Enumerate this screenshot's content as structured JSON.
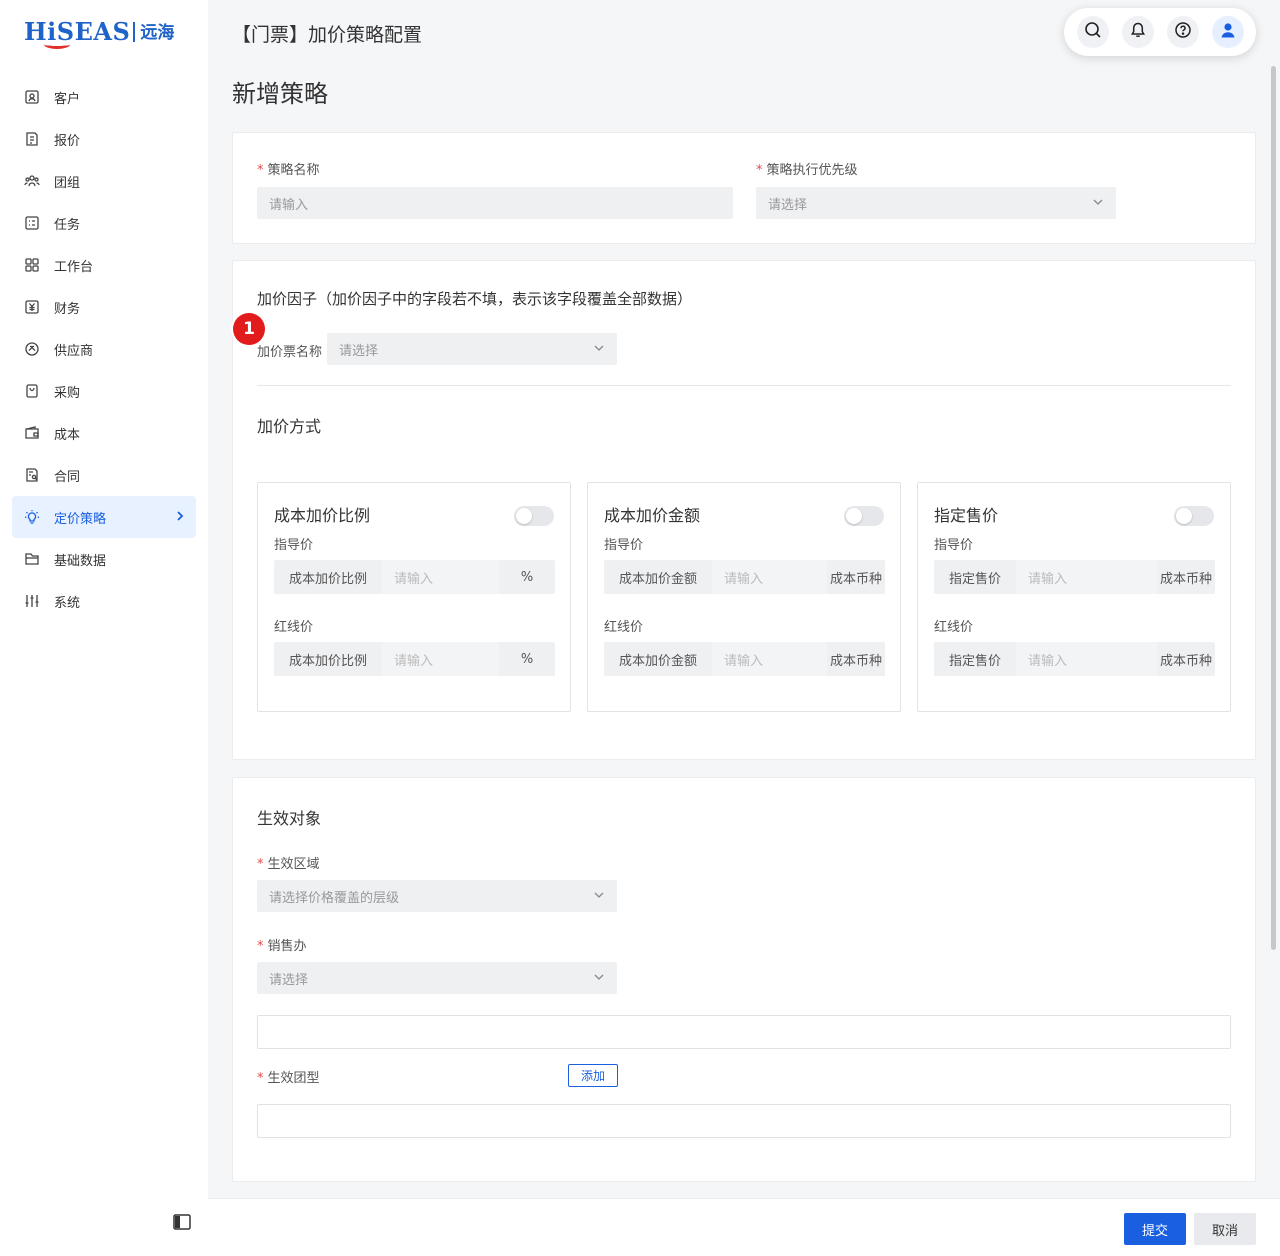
{
  "brand": {
    "name": "HiSEAS",
    "cn": "远海"
  },
  "nav": [
    {
      "label": "客户",
      "icon": "customer-icon"
    },
    {
      "label": "报价",
      "icon": "quote-icon"
    },
    {
      "label": "团组",
      "icon": "group-icon"
    },
    {
      "label": "任务",
      "icon": "task-icon"
    },
    {
      "label": "工作台",
      "icon": "workbench-icon"
    },
    {
      "label": "财务",
      "icon": "finance-icon"
    },
    {
      "label": "供应商",
      "icon": "supplier-icon"
    },
    {
      "label": "采购",
      "icon": "purchase-icon"
    },
    {
      "label": "成本",
      "icon": "cost-icon"
    },
    {
      "label": "合同",
      "icon": "contract-icon"
    },
    {
      "label": "定价策略",
      "icon": "lightbulb-icon",
      "active": true
    },
    {
      "label": "基础数据",
      "icon": "folder-icon"
    },
    {
      "label": "系统",
      "icon": "sliders-icon"
    }
  ],
  "header": {
    "title": "【门票】加价策略配置"
  },
  "page": {
    "title": "新增策略"
  },
  "basic": {
    "name_label": "策略名称",
    "name_placeholder": "请输入",
    "priority_label": "策略执行优先级",
    "priority_placeholder": "请选择"
  },
  "factor": {
    "title": "加价因子（加价因子中的字段若不填，表示该字段覆盖全部数据）",
    "ticket_label": "加价票名称",
    "ticket_placeholder": "请选择",
    "badge": "1"
  },
  "method": {
    "title": "加价方式",
    "cards": [
      {
        "title": "成本加价比例",
        "guide": "指导价",
        "red": "红线价",
        "prefix": "成本加价比例",
        "placeholder": "请输入",
        "suffix": "%"
      },
      {
        "title": "成本加价金额",
        "guide": "指导价",
        "red": "红线价",
        "prefix": "成本加价金额",
        "placeholder": "请输入",
        "suffix": "成本币种"
      },
      {
        "title": "指定售价",
        "guide": "指导价",
        "red": "红线价",
        "prefix": "指定售价",
        "placeholder": "请输入",
        "suffix": "成本币种"
      }
    ]
  },
  "target": {
    "title": "生效对象",
    "region_label": "生效区域",
    "region_placeholder": "请选择价格覆盖的层级",
    "office_label": "销售办",
    "office_placeholder": "请选择",
    "group_label": "生效团型",
    "add_label": "添加"
  },
  "footer": {
    "submit": "提交",
    "cancel": "取消"
  },
  "colors": {
    "primary": "#1a5fe0",
    "required": "#e54b4b",
    "badge": "#e21c1c"
  }
}
